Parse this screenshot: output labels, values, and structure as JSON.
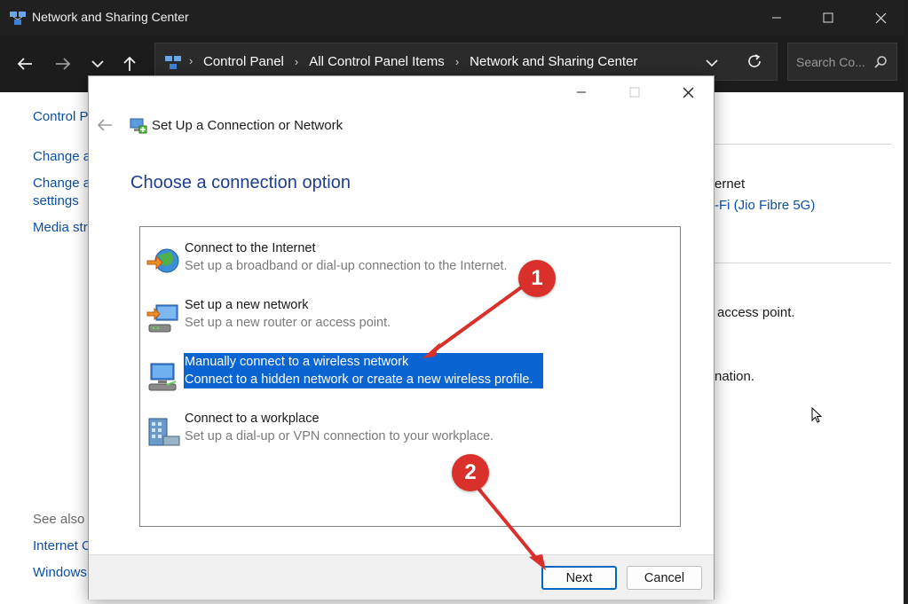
{
  "window": {
    "title": "Network and Sharing Center"
  },
  "nav": {
    "breadcrumbs": [
      "Control Panel",
      "All Control Panel Items",
      "Network and Sharing Center"
    ],
    "search_placeholder": "Search Co..."
  },
  "background": {
    "left_links": [
      "Control Pa",
      "Change a",
      "Change a",
      "settings",
      "Media str"
    ],
    "see_also_label": "See also",
    "see_also_links": [
      "Internet O",
      "Windows"
    ],
    "right_texts": [
      "ernet",
      "-Fi (Jio Fibre 5G)",
      "access point.",
      "nation."
    ]
  },
  "dialog": {
    "title": "Set Up a Connection or Network",
    "heading": "Choose a connection option",
    "options": [
      {
        "title": "Connect to the Internet",
        "description": "Set up a broadband or dial-up connection to the Internet."
      },
      {
        "title": "Set up a new network",
        "description": "Set up a new router or access point."
      },
      {
        "title": "Manually connect to a wireless network",
        "description": "Connect to a hidden network or create a new wireless profile."
      },
      {
        "title": "Connect to a workplace",
        "description": "Set up a dial-up or VPN connection to your workplace."
      }
    ],
    "selected_index": 2,
    "buttons": {
      "next": "Next",
      "cancel": "Cancel"
    }
  },
  "annotations": {
    "badge1": "1",
    "badge2": "2"
  },
  "colors": {
    "titlebar": "#202020",
    "heading": "#1e3e8c",
    "selection": "#0a64d2",
    "badge": "#d9302b",
    "arrow": "#d9302b"
  }
}
